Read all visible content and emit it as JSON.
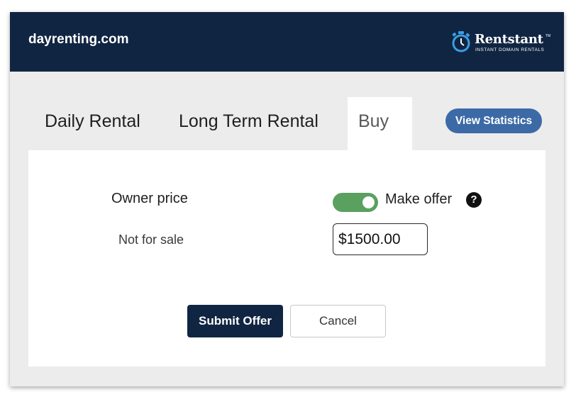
{
  "header": {
    "site_name": "dayrenting.com",
    "logo": {
      "name": "Rentstant",
      "trademark": "TM",
      "tagline": "INSTANT DOMAIN RENTALS",
      "icon": "stopwatch-icon"
    }
  },
  "tabs": [
    {
      "label": "Daily Rental",
      "active": false
    },
    {
      "label": "Long Term Rental",
      "active": false
    },
    {
      "label": "Buy",
      "active": true
    }
  ],
  "view_statistics_label": "View Statistics",
  "form": {
    "owner_price_label": "Owner price",
    "owner_price_value": "Not for sale",
    "make_offer_toggle_on": true,
    "make_offer_label": "Make offer",
    "help_icon": "question-circle-icon",
    "offer_value": "$1500.00",
    "submit_label": "Submit Offer",
    "cancel_label": "Cancel"
  },
  "colors": {
    "header_bg": "#102542",
    "accent_blue": "#3c6aa6",
    "toggle_green": "#5aa05f",
    "submit_bg": "#102542"
  }
}
